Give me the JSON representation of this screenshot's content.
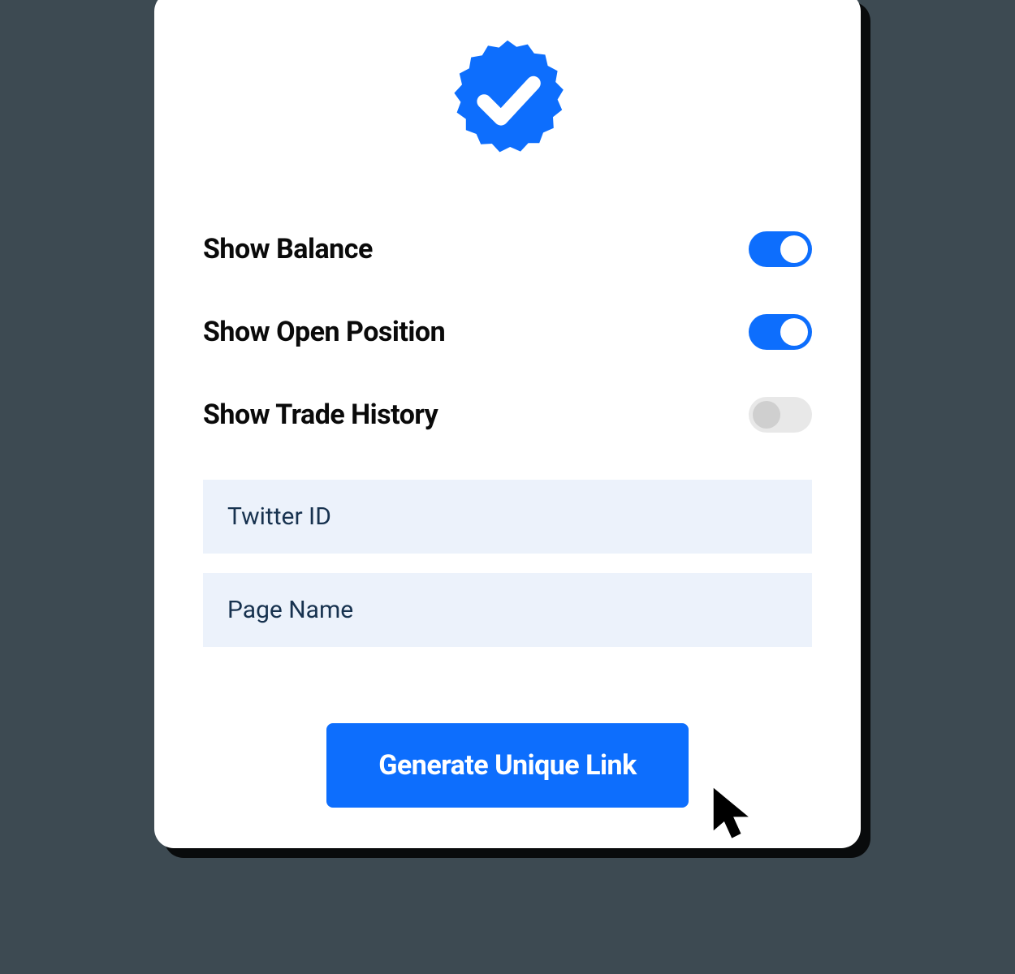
{
  "toggles": [
    {
      "label": "Show Balance",
      "on": true
    },
    {
      "label": "Show Open Position",
      "on": true
    },
    {
      "label": "Show Trade History",
      "on": false
    }
  ],
  "inputs": {
    "twitter_placeholder": "Twitter ID",
    "page_name_placeholder": "Page Name"
  },
  "button": {
    "label": "Generate Unique Link"
  },
  "colors": {
    "accent": "#0d6efd",
    "input_bg": "#ecf2fb",
    "toggle_off_bg": "#e8e8e8",
    "toggle_off_knob": "#cfcfcf"
  }
}
